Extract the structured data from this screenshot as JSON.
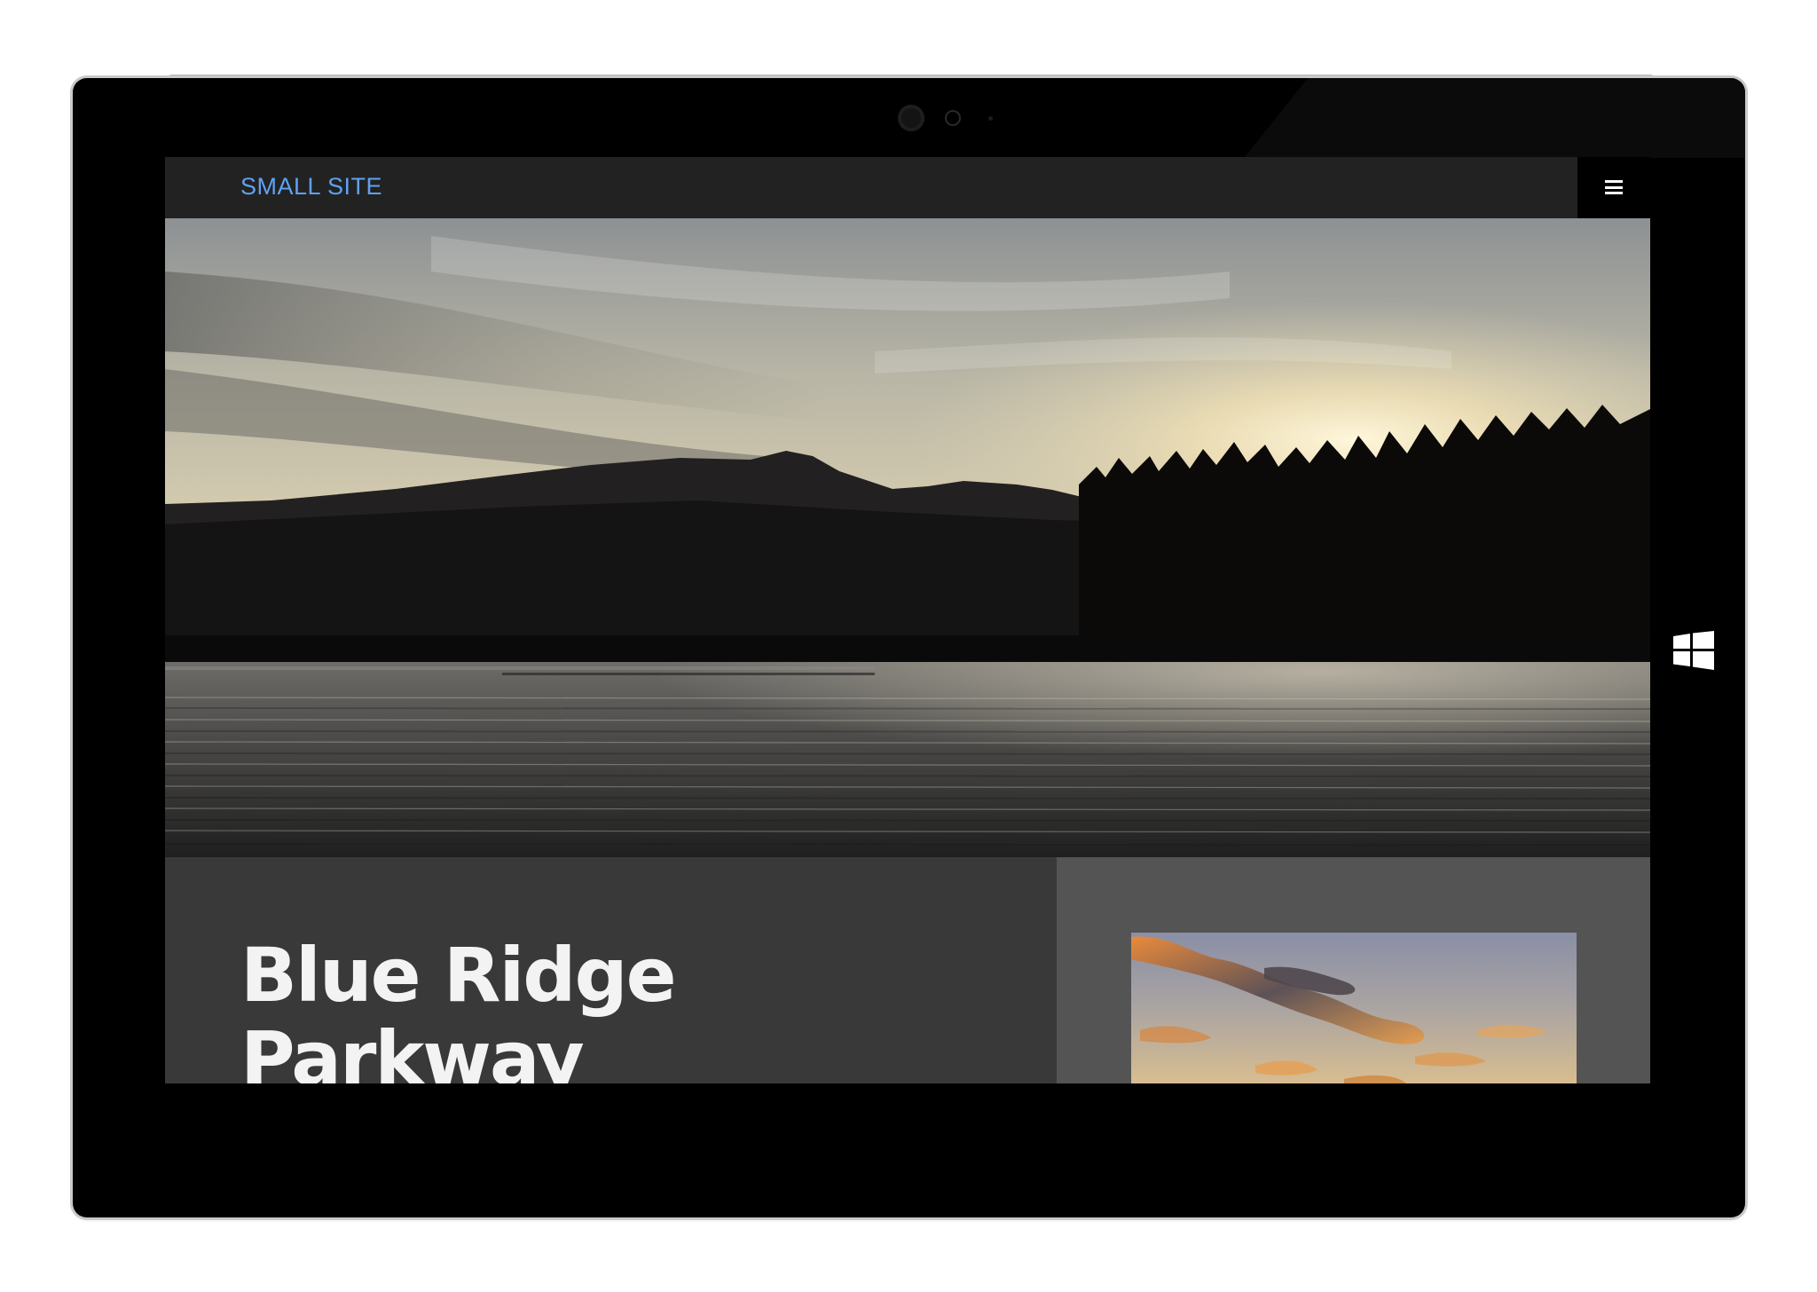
{
  "device": {
    "windows_button_icon": "windows-logo-icon"
  },
  "navbar": {
    "site_title": "SMALL SITE",
    "menu_icon": "hamburger-menu-icon"
  },
  "hero": {
    "image_subject": "lake-sunset-mountains-photo"
  },
  "content": {
    "heading_line1": "Blue Ridge",
    "heading_line2": "Parkway",
    "thumbnail_subject": "sunset-clouds-photo"
  },
  "colors": {
    "accent": "#5ea2f2",
    "navbar_bg": "#222222",
    "panel_left_bg": "#393939",
    "panel_right_bg": "#545454"
  }
}
